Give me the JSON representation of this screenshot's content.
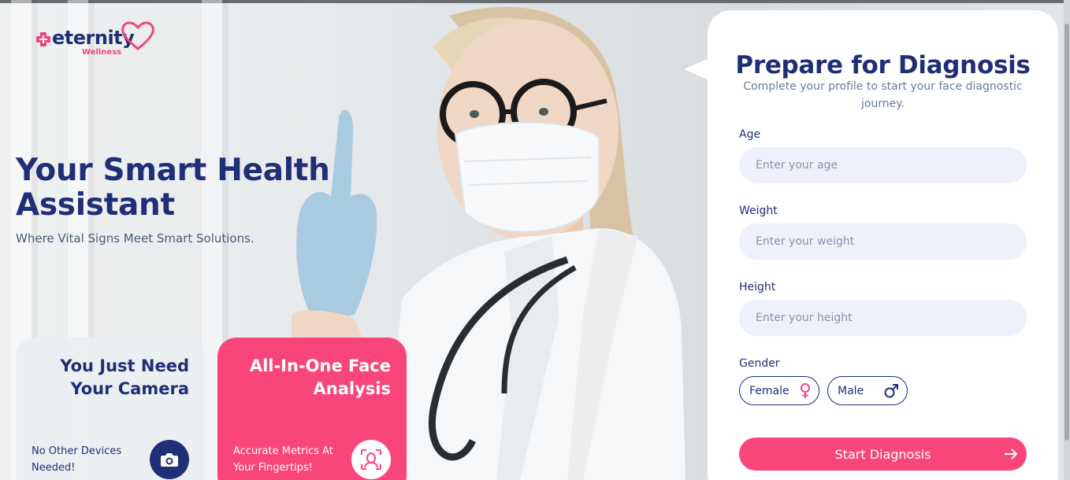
{
  "brand": {
    "name": "eternity",
    "tagline": "Wellness",
    "primary_color": "#1f2f77",
    "accent_color": "#f9467a"
  },
  "hero": {
    "title": "Your Smart Health Assistant",
    "subtitle": "Where Vital Signs Meet Smart Solutions."
  },
  "cards": {
    "camera": {
      "title": "You Just Need Your Camera",
      "note": "No Other Devices Needed!",
      "icon": "camera-icon"
    },
    "face": {
      "title": "All-In-One Face Analysis",
      "note": "Accurate Metrics At Your Fingertips!",
      "icon": "face-scan-icon"
    }
  },
  "form": {
    "title": "Prepare for Diagnosis",
    "subtitle": "Complete your profile to start your face diagnostic journey.",
    "age": {
      "label": "Age",
      "placeholder": "Enter your age",
      "value": ""
    },
    "weight": {
      "label": "Weight",
      "placeholder": "Enter your weight",
      "value": ""
    },
    "height": {
      "label": "Height",
      "placeholder": "Enter your height",
      "value": ""
    },
    "gender": {
      "label": "Gender",
      "options": [
        {
          "label": "Female",
          "icon": "female-symbol-icon"
        },
        {
          "label": "Male",
          "icon": "male-symbol-icon"
        }
      ]
    },
    "submit_label": "Start Diagnosis",
    "submit_icon": "arrow-right-icon"
  }
}
